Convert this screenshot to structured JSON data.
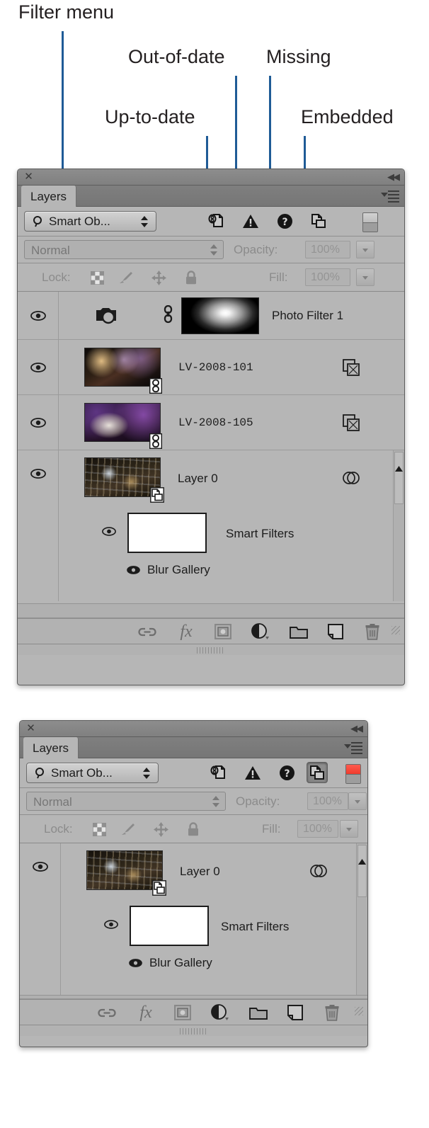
{
  "annotations": [
    {
      "id": "filter-menu",
      "label": "Filter menu"
    },
    {
      "id": "up-to-date",
      "label": "Up-to-date"
    },
    {
      "id": "out-of-date",
      "label": "Out-of-date"
    },
    {
      "id": "missing",
      "label": "Missing"
    },
    {
      "id": "embedded",
      "label": "Embedded"
    }
  ],
  "accent_color": "#1f5b96",
  "panel_bg": "#b6b6b6",
  "active_toggle_color": "#f03b2c",
  "panel1": {
    "titlebar": {
      "close_icon": "close-icon",
      "collapse_icon": "collapse-double-arrow-icon"
    },
    "tab": {
      "label": "Layers",
      "menu_icon": "panel-menu-icon"
    },
    "filter_bar": {
      "search_icon": "magnifier-icon",
      "filter_type": "Smart Ob...",
      "stepper_icon": "up-down-arrows-icon",
      "icons": [
        {
          "name": "up-to-date-icon",
          "active": false
        },
        {
          "name": "out-of-date-warning-icon",
          "active": false
        },
        {
          "name": "missing-question-icon",
          "active": false
        },
        {
          "name": "embedded-icon",
          "active": false
        }
      ],
      "toggle_on": false
    },
    "blend_bar": {
      "blend_mode": "Normal",
      "opacity_label": "Opacity:",
      "opacity_value": "100%"
    },
    "lock_bar": {
      "lock_label": "Lock:",
      "lock_icons": [
        "lock-transparent-pixels-icon",
        "lock-image-pixels-brush-icon",
        "lock-position-move-icon",
        "lock-all-padlock-icon"
      ],
      "fill_label": "Fill:",
      "fill_value": "100%"
    },
    "layers": [
      {
        "name": "Photo Filter 1",
        "visible": true,
        "eye_icon": "eye-icon",
        "adjustment_icon": "photo-filter-camera-icon",
        "link_icon": "mask-link-icon",
        "thumb": "radial-gradient-mask",
        "badge": null,
        "right_icon": null
      },
      {
        "name": "LV-2008-101",
        "visible": true,
        "eye_icon": "eye-icon",
        "thumb": "galaxy-photo",
        "badge": "linked-smart-object-badge",
        "right_icon": "linked-smart-object-icon"
      },
      {
        "name": "LV-2008-105",
        "visible": true,
        "eye_icon": "eye-icon",
        "thumb": "sculpture-photo",
        "badge": "linked-smart-object-badge",
        "right_icon": "linked-smart-object-icon"
      },
      {
        "name": "Layer 0",
        "visible": true,
        "eye_icon": "eye-icon",
        "thumb": "city-photo",
        "badge": "embedded-smart-object-badge",
        "right_icon": "smart-filter-icon"
      }
    ],
    "smart_filters": {
      "mask_label": "Smart Filters",
      "mask_visible": true,
      "filters": [
        {
          "name": "Blur Gallery",
          "visible": true
        }
      ]
    },
    "toolbar_icons": [
      "link-layers-icon",
      "add-layer-style-fx-icon",
      "add-layer-mask-icon",
      "new-fill-adjustment-layer-icon",
      "new-group-folder-icon",
      "new-layer-icon",
      "delete-layer-trash-icon"
    ]
  },
  "panel2": {
    "titlebar": {
      "close_icon": "close-icon",
      "collapse_icon": "collapse-double-arrow-icon"
    },
    "tab": {
      "label": "Layers",
      "menu_icon": "panel-menu-icon"
    },
    "filter_bar": {
      "search_icon": "magnifier-icon",
      "filter_type": "Smart Ob...",
      "stepper_icon": "up-down-arrows-icon",
      "icons": [
        {
          "name": "up-to-date-icon",
          "active": false
        },
        {
          "name": "out-of-date-warning-icon",
          "active": false
        },
        {
          "name": "missing-question-icon",
          "active": false
        },
        {
          "name": "embedded-icon",
          "active": true
        }
      ],
      "toggle_on": true
    },
    "blend_bar": {
      "blend_mode": "Normal",
      "opacity_label": "Opacity:",
      "opacity_value": "100%"
    },
    "lock_bar": {
      "lock_label": "Lock:",
      "lock_icons": [
        "lock-transparent-pixels-icon",
        "lock-image-pixels-brush-icon",
        "lock-position-move-icon",
        "lock-all-padlock-icon"
      ],
      "fill_label": "Fill:",
      "fill_value": "100%"
    },
    "layers": [
      {
        "name": "Layer 0",
        "visible": true,
        "eye_icon": "eye-icon",
        "thumb": "city-photo",
        "badge": "embedded-smart-object-badge",
        "right_icon": "smart-filter-icon"
      }
    ],
    "smart_filters": {
      "mask_label": "Smart Filters",
      "mask_visible": true,
      "filters": [
        {
          "name": "Blur Gallery",
          "visible": true
        }
      ]
    },
    "toolbar_icons": [
      "link-layers-icon",
      "add-layer-style-fx-icon",
      "add-layer-mask-icon",
      "new-fill-adjustment-layer-icon",
      "new-group-folder-icon",
      "new-layer-icon",
      "delete-layer-trash-icon"
    ]
  }
}
